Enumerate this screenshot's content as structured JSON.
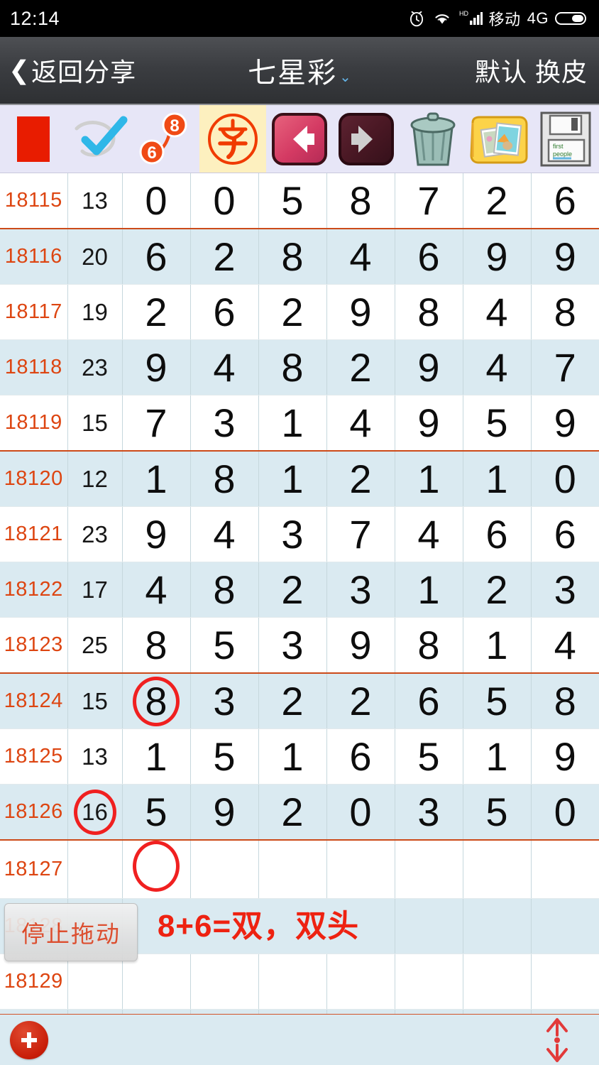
{
  "statusbar": {
    "time": "12:14",
    "alarm_icon": "alarm-icon",
    "wifi_icon": "wifi-icon",
    "hd_label": "HD",
    "signal_icon": "signal-bars-icon",
    "carrier": "移动",
    "network": "4G",
    "battery_icon": "battery-icon"
  },
  "navbar": {
    "back_chevron": "❮",
    "back_label": "返回分享",
    "title": "七星彩",
    "title_caret": "⌄",
    "right_label": "默认 换皮"
  },
  "toolbar": {
    "items": [
      {
        "name": "red-square-icon",
        "label": ""
      },
      {
        "name": "blue-check-icon",
        "label": ""
      },
      {
        "name": "six-eight-link-icon",
        "label": "",
        "badge_a": "6",
        "badge_b": "8"
      },
      {
        "name": "zi-character-icon",
        "label": "字",
        "selected": true
      },
      {
        "name": "arrow-left-icon",
        "label": ""
      },
      {
        "name": "arrow-right-icon",
        "label": ""
      },
      {
        "name": "trash-can-icon",
        "label": ""
      },
      {
        "name": "photo-album-icon",
        "label": ""
      },
      {
        "name": "floppy-save-icon",
        "label": "",
        "floppy_line1": "first",
        "floppy_line2": "people"
      }
    ]
  },
  "table": {
    "rows": [
      {
        "id": "18115",
        "sum": "13",
        "digits": [
          "0",
          "0",
          "5",
          "8",
          "7",
          "2",
          "6"
        ]
      },
      {
        "id": "18116",
        "sum": "20",
        "digits": [
          "6",
          "2",
          "8",
          "4",
          "6",
          "9",
          "9"
        ],
        "thick_top": true
      },
      {
        "id": "18117",
        "sum": "19",
        "digits": [
          "2",
          "6",
          "2",
          "9",
          "8",
          "4",
          "8"
        ]
      },
      {
        "id": "18118",
        "sum": "23",
        "digits": [
          "9",
          "4",
          "8",
          "2",
          "9",
          "4",
          "7"
        ]
      },
      {
        "id": "18119",
        "sum": "15",
        "digits": [
          "7",
          "3",
          "1",
          "4",
          "9",
          "5",
          "9"
        ]
      },
      {
        "id": "18120",
        "sum": "12",
        "digits": [
          "1",
          "8",
          "1",
          "2",
          "1",
          "1",
          "0"
        ],
        "thick_top": true
      },
      {
        "id": "18121",
        "sum": "23",
        "digits": [
          "9",
          "4",
          "3",
          "7",
          "4",
          "6",
          "6"
        ]
      },
      {
        "id": "18122",
        "sum": "17",
        "digits": [
          "4",
          "8",
          "2",
          "3",
          "1",
          "2",
          "3"
        ]
      },
      {
        "id": "18123",
        "sum": "25",
        "digits": [
          "8",
          "5",
          "3",
          "9",
          "8",
          "1",
          "4"
        ]
      },
      {
        "id": "18124",
        "sum": "15",
        "digits": [
          "8",
          "3",
          "2",
          "2",
          "6",
          "5",
          "8"
        ],
        "thick_top": true,
        "circle_digit": 0
      },
      {
        "id": "18125",
        "sum": "13",
        "digits": [
          "1",
          "5",
          "1",
          "6",
          "5",
          "1",
          "9"
        ]
      },
      {
        "id": "18126",
        "sum": "16",
        "digits": [
          "5",
          "9",
          "2",
          "0",
          "3",
          "5",
          "0"
        ],
        "circle_sum": true
      },
      {
        "id": "18127",
        "sum": "",
        "digits": [
          "",
          "",
          "",
          "",
          "",
          "",
          ""
        ],
        "circle_empty": 0,
        "thick_top": true
      },
      {
        "id": "18128",
        "sum": "",
        "digits": [
          "",
          "",
          "",
          "",
          "",
          "",
          ""
        ],
        "note": "8+6=双，双头"
      },
      {
        "id": "18129",
        "sum": "",
        "digits": [
          "",
          "",
          "",
          "",
          "",
          "",
          ""
        ]
      },
      {
        "id": "",
        "sum": "",
        "digits": [
          "",
          "",
          "",
          "",
          "",
          "",
          ""
        ]
      }
    ]
  },
  "drag_button": {
    "label": "停止拖动"
  },
  "bottombar": {
    "add_icon": "add-plus-icon",
    "scroll_icon": "scroll-up-down-icon"
  },
  "colors": {
    "accent_orange": "#dd4511",
    "grid_line": "#d2542a",
    "row_alt": "#daeaf1",
    "mark_red": "#f02020",
    "toolbar_bg": "#e7e6f7",
    "selected_cell": "#fdf0bf"
  }
}
